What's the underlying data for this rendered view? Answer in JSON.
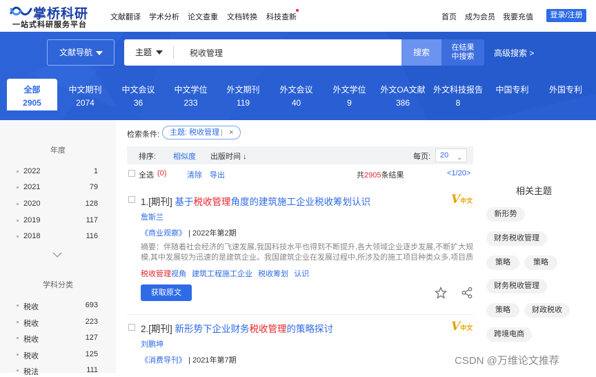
{
  "brand": {
    "name": "掌桥科研",
    "slogan": "一站式科研服务平台"
  },
  "topnav": {
    "items": [
      "文献翻译",
      "学术分析",
      "论文查重",
      "文档转换",
      "科技查新"
    ],
    "right_links": [
      "首页",
      "成为会员",
      "我要充值"
    ],
    "login": "登录/注册"
  },
  "search": {
    "nav_button": "文献导航",
    "scope": "主题",
    "query": "税收管理",
    "search_button": "搜索",
    "search_within": [
      "在结果",
      "中搜索"
    ],
    "advanced": "高级搜索 >"
  },
  "tabs": [
    {
      "label": "全部",
      "count": "2905"
    },
    {
      "label": "中文期刊",
      "count": "2074"
    },
    {
      "label": "中文会议",
      "count": "36"
    },
    {
      "label": "中文学位",
      "count": "233"
    },
    {
      "label": "外文期刊",
      "count": "119"
    },
    {
      "label": "外文会议",
      "count": "40"
    },
    {
      "label": "外文学位",
      "count": "9"
    },
    {
      "label": "外文OA文献",
      "count": "386"
    },
    {
      "label": "外文科技报告",
      "count": "8"
    },
    {
      "label": "中国专利",
      "count": ""
    },
    {
      "label": "外国专利",
      "count": ""
    }
  ],
  "sidebar": {
    "year_title": "年度",
    "years": [
      {
        "label": "2022",
        "count": "1"
      },
      {
        "label": "2021",
        "count": "79"
      },
      {
        "label": "2020",
        "count": "128"
      },
      {
        "label": "2019",
        "count": "117"
      },
      {
        "label": "2018",
        "count": "116"
      }
    ],
    "subject_title": "学科分类",
    "subjects": [
      {
        "label": "税收",
        "count": "693"
      },
      {
        "label": "税收",
        "count": "223"
      },
      {
        "label": "税收",
        "count": "127"
      },
      {
        "label": "税收",
        "count": "125"
      },
      {
        "label": "税法",
        "count": "111"
      }
    ]
  },
  "criteria": {
    "label": "检索条件:",
    "tag": "主题: 税收管理",
    "tag_sep": "|",
    "close": "×"
  },
  "sortbar": {
    "sort_label": "排序:",
    "relevance": "相似度",
    "time": "出版时间 ↓",
    "per_page_label": "每页:",
    "per_page": "20",
    "per_page_caret": "⌄"
  },
  "selectbar": {
    "select_all": "全选",
    "selected": "(0)",
    "clear": "清除",
    "export": "导出",
    "total_prefix": "共",
    "total": "2905",
    "total_suffix": "条结果",
    "page": "<1/20>"
  },
  "results": [
    {
      "index": "1.[期刊]",
      "title_pre": "基于",
      "title_hl": "税收管理",
      "title_post": "角度的建筑施工企业税收筹划认识",
      "author": "詹斯兰",
      "journal": "《商业观察》",
      "issue": "| 2022年第2期",
      "abstract": "摘要：伴随着社会经济的飞速发展,我国科技水平也得到不断提升,各大领域企业逐步发展,不断扩大规模,其中发展较为迅速的是建筑企业。我国建筑企业在发展过程中,所涉及的施工项目种类众多,项目质量对于...",
      "keywords": [
        {
          "hl": "税收管理",
          "rest": "视角"
        },
        {
          "hl": "",
          "rest": "建筑工程施工企业"
        },
        {
          "hl": "",
          "rest": "税收筹划"
        },
        {
          "hl": "",
          "rest": "认识"
        }
      ],
      "button": "获取原文",
      "badge": "中文"
    },
    {
      "index": "2.[期刊]",
      "title_pre": "新形势下企业财务",
      "title_hl": "税收管理",
      "title_post": "的策略探讨",
      "author": "刘鹏坤",
      "journal": "《消费导刊》",
      "issue": "| 2021年第7期",
      "badge": "中文"
    }
  ],
  "related": {
    "title": "相关主题",
    "tags": [
      "新形势",
      "财务税收管理",
      "策略",
      "策略",
      "财务税收管理",
      "策略",
      "财政税收",
      "跨境电商"
    ]
  },
  "watermark": "CSDN @万维论文推荐",
  "colors": {
    "brand_blue": "#2e6be6",
    "hero_blue": "#2a5fd3",
    "highlight_red": "#e5242b"
  }
}
